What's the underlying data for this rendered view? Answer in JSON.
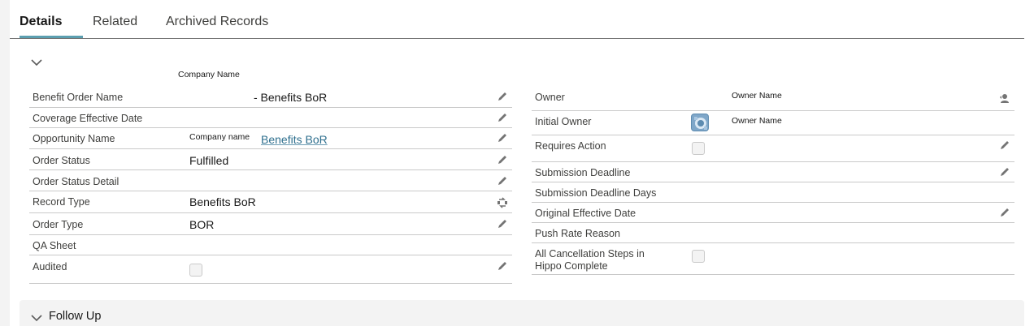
{
  "tabs": [
    {
      "label": "Details"
    },
    {
      "label": "Related"
    },
    {
      "label": "Archived Records"
    }
  ],
  "section": {
    "company_name_caption": "Company Name"
  },
  "left_fields": {
    "benefit_order_name": {
      "label": "Benefit Order Name",
      "value": "- Benefits BoR"
    },
    "coverage_effective_date": {
      "label": "Coverage Effective Date",
      "value": ""
    },
    "opportunity_name": {
      "label": "Opportunity Name",
      "prefix": "Company name",
      "link": "Benefits BoR"
    },
    "order_status": {
      "label": "Order Status",
      "value": "Fulfilled"
    },
    "order_status_detail": {
      "label": "Order Status Detail",
      "value": ""
    },
    "record_type": {
      "label": "Record Type",
      "value": "Benefits BoR"
    },
    "order_type": {
      "label": "Order Type",
      "value": "BOR"
    },
    "qa_sheet": {
      "label": "QA Sheet",
      "value": ""
    },
    "audited": {
      "label": "Audited",
      "checked": false
    }
  },
  "right_fields": {
    "owner": {
      "label": "Owner",
      "value": "Owner Name"
    },
    "initial_owner": {
      "label": "Initial Owner",
      "value": "Owner Name"
    },
    "requires_action": {
      "label": "Requires Action",
      "checked": false
    },
    "submission_deadline": {
      "label": "Submission Deadline",
      "value": ""
    },
    "submission_deadline_days": {
      "label": "Submission Deadline Days",
      "value": ""
    },
    "original_effective_date": {
      "label": "Original Effective Date",
      "value": ""
    },
    "push_rate_reason": {
      "label": "Push Rate Reason",
      "value": ""
    },
    "all_cancellation_steps": {
      "label_line1": "All Cancellation Steps in",
      "label_line2": "Hippo Complete",
      "checked": false
    }
  },
  "follow_up": {
    "label": "Follow Up"
  },
  "icons": {
    "edit": "pencil-icon",
    "change_owner": "change-owner-icon",
    "change_record_type": "change-record-type-icon",
    "collapse": "chevron-down-icon"
  }
}
